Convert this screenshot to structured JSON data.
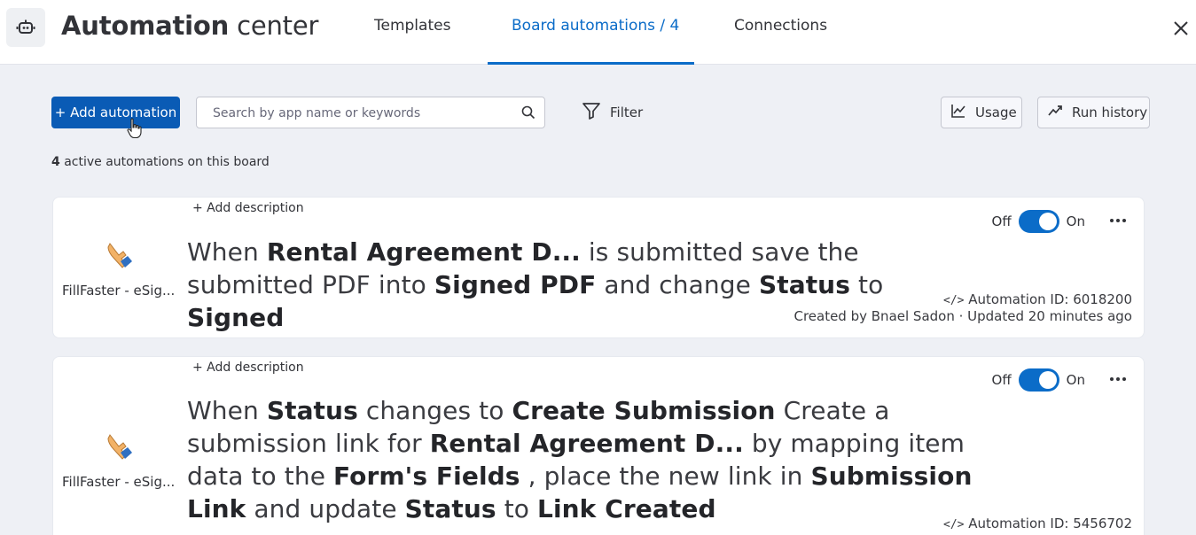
{
  "header": {
    "title_bold": "Automation",
    "title_light": "center",
    "tabs": [
      {
        "label": "Templates"
      },
      {
        "label": "Board automations / 4"
      },
      {
        "label": "Connections"
      }
    ]
  },
  "toolbar": {
    "add_label": "+ Add automation",
    "search_placeholder": "Search by app name or keywords",
    "filter_label": "Filter",
    "usage_label": "Usage",
    "run_history_label": "Run history"
  },
  "summary": {
    "count": "4",
    "text": "active automations on this board"
  },
  "cards": [
    {
      "app_name": "FillFaster - eSig...",
      "add_description": "+ Add description",
      "toggle_off": "Off",
      "toggle_on": "On",
      "enabled": true,
      "sentence": [
        {
          "t": "When ",
          "b": false
        },
        {
          "t": "Rental Agreement D...",
          "b": true
        },
        {
          "t": "  is submitted save the submitted PDF into ",
          "b": false
        },
        {
          "t": "Signed PDF",
          "b": true
        },
        {
          "t": " and change ",
          "b": false
        },
        {
          "t": "Status",
          "b": true
        },
        {
          "t": " to ",
          "b": false
        },
        {
          "t": "Signed",
          "b": true
        }
      ],
      "automation_id": "Automation ID: 6018200",
      "created_line": "Created by Bnael Sadon · Updated 20 minutes ago"
    },
    {
      "app_name": "FillFaster - eSig...",
      "add_description": "+ Add description",
      "toggle_off": "Off",
      "toggle_on": "On",
      "enabled": true,
      "sentence": [
        {
          "t": "When ",
          "b": false
        },
        {
          "t": "Status",
          "b": true
        },
        {
          "t": " changes to ",
          "b": false
        },
        {
          "t": "Create Submission",
          "b": true
        },
        {
          "t": " Create a submission link for ",
          "b": false
        },
        {
          "t": "Rental Agreement D...",
          "b": true
        },
        {
          "t": "  by mapping item data to the ",
          "b": false
        },
        {
          "t": "Form's Fields",
          "b": true
        },
        {
          "t": " , place the new link in ",
          "b": false
        },
        {
          "t": "Submission Link",
          "b": true
        },
        {
          "t": " and update ",
          "b": false
        },
        {
          "t": "Status",
          "b": true
        },
        {
          "t": " to ",
          "b": false
        },
        {
          "t": "Link Created",
          "b": true
        }
      ],
      "automation_id": "Automation ID: 5456702",
      "created_line": ""
    }
  ],
  "colors": {
    "accent": "#0b6cc8",
    "primary_button": "#0a5bb5",
    "background": "#eef0f5"
  }
}
